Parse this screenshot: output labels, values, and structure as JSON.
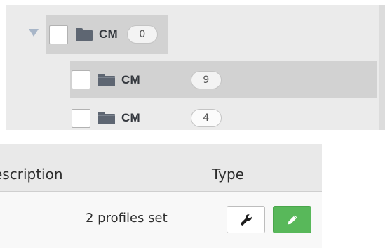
{
  "tree": {
    "root": {
      "label": "CM",
      "count": "0",
      "expanded": true
    },
    "children": [
      {
        "label": "CM",
        "count": "9",
        "selected": true
      },
      {
        "label": "CM",
        "count": "4",
        "selected": false
      }
    ]
  },
  "table": {
    "columns": {
      "description": "escription",
      "type": "Type"
    },
    "rows": [
      {
        "description": "2 profiles set",
        "actions": [
          "wrench-icon",
          "pencil-icon"
        ]
      }
    ]
  },
  "colors": {
    "selected_row": "#d2d2d2",
    "panel_bg": "#ebebeb",
    "edit_button": "#58b85a",
    "folder_icon": "#5e6672"
  }
}
